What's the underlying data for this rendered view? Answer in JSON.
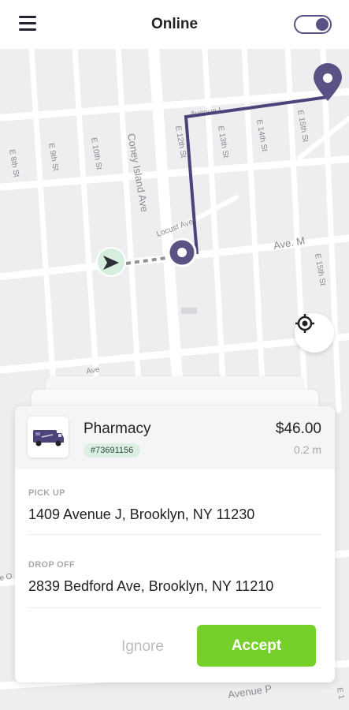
{
  "header": {
    "title": "Online",
    "toggle_on": true
  },
  "map": {
    "streets": {
      "e8": "E 8th St",
      "e9": "E 9th St",
      "e10": "E 10th St",
      "coney": "Coney Island Ave",
      "aveL": "Avenue L",
      "e13": "E 13th St",
      "e14": "E 14th St",
      "e15_top": "E 15th St",
      "e12": "E 12th St",
      "locust": "Locust Ave",
      "aveM": "Ave. M",
      "e15_mid": "E 15th St",
      "ave_lower": "Ave",
      "ave_o": "e O",
      "ave_p": "Avenue P",
      "e_br": "E 1"
    },
    "route_color": "#4b437a",
    "icons": [
      "navigation-arrow-icon",
      "origin-pin-icon",
      "destination-pin-icon",
      "crosshair-locate-icon"
    ]
  },
  "order": {
    "store_name": "Pharmacy",
    "order_id": "#73691156",
    "price": "$46.00",
    "distance": "0.2 m",
    "pickup_label": "PICK UP",
    "pickup_address": "1409 Avenue J, Brooklyn, NY 11230",
    "dropoff_label": "DROP OFF",
    "dropoff_address": "2839 Bedford Ave, Brooklyn, NY 11210"
  },
  "actions": {
    "ignore_label": "Ignore",
    "accept_label": "Accept",
    "accept_color": "#76d02a"
  }
}
